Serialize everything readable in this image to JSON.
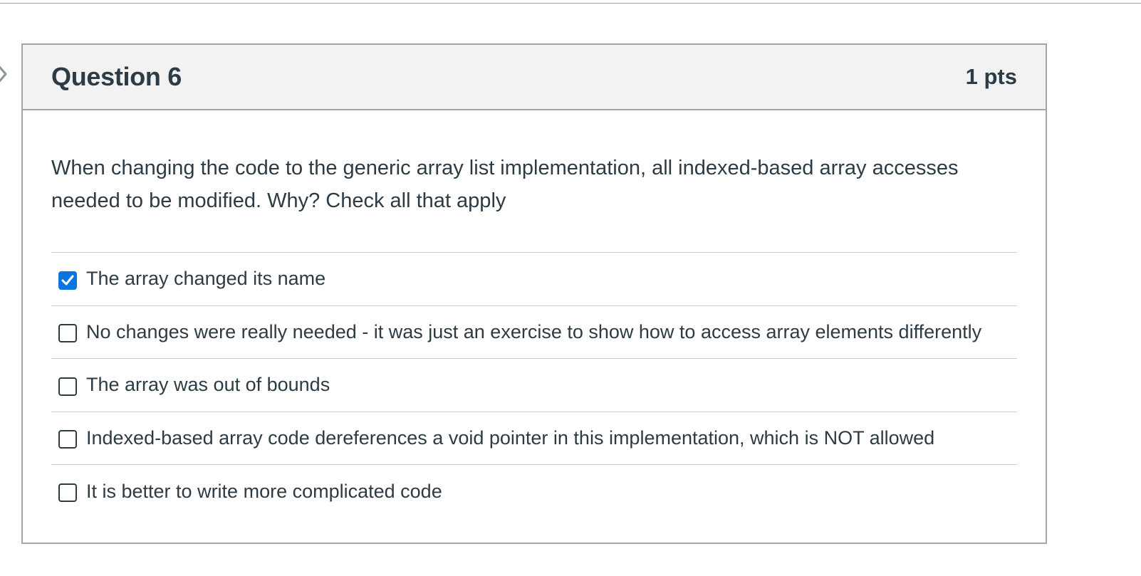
{
  "question": {
    "title": "Question 6",
    "points": "1 pts",
    "text": "When changing the code to the generic array list implementation, all indexed-based array accesses needed to be modified. Why? Check all that apply"
  },
  "answers": [
    {
      "label": "The array changed its name",
      "checked": true
    },
    {
      "label": "No changes were really needed - it was just an exercise to show how to access array elements differently",
      "checked": false
    },
    {
      "label": "The array was out of bounds",
      "checked": false
    },
    {
      "label": "Indexed-based array code dereferences a void pointer in this implementation, which is NOT allowed",
      "checked": false
    },
    {
      "label": "It is better to write more complicated code",
      "checked": false
    }
  ],
  "colors": {
    "accent": "#0b74de",
    "header_bg": "#f2f2f2",
    "text": "#2d3b45"
  },
  "icons": {
    "nav": "chevron-right-icon",
    "check": "checkmark-icon"
  }
}
